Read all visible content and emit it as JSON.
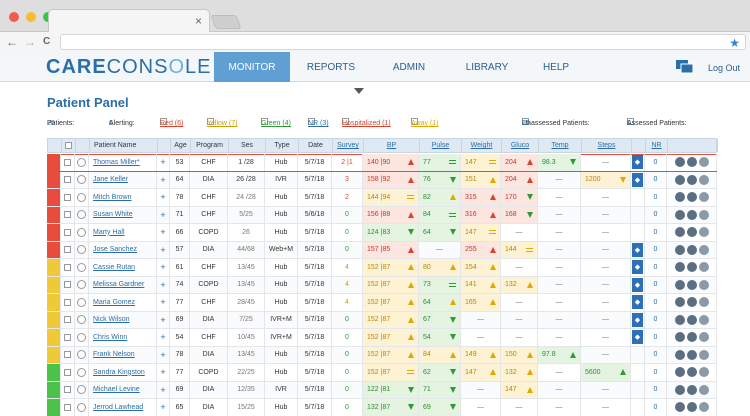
{
  "browser": {
    "close_glyph": "×",
    "back": "←",
    "forward": "→",
    "reload": "C",
    "bookmark": "★"
  },
  "header": {
    "logo_part1": "CARE",
    "logo_part2": "CONS",
    "logo_part3": "O",
    "logo_part4": "LE",
    "nav": [
      "MONITOR",
      "REPORTS",
      "ADMIN",
      "LIBRARY",
      "HELP"
    ],
    "active_nav": "MONITOR",
    "logout": "Log Out"
  },
  "panel": {
    "title": "Patient Panel",
    "patients_label": "Patients:",
    "patients_count": "20",
    "alerting_label": "Alerting:",
    "alerting_count": "6",
    "filters": [
      {
        "label": "Red (6)",
        "color": "#d9442d"
      },
      {
        "label": "Yellow (7)",
        "color": "#c8a000"
      },
      {
        "label": "Green (4)",
        "color": "#2e9a3a"
      },
      {
        "label": "NR (3)",
        "color": "#2b6ea8"
      },
      {
        "label": "Hospitalized (1)",
        "color": "#d9442d"
      },
      {
        "label": "Away (1)",
        "color": "#e0a800"
      }
    ],
    "unassessed_label": "Unassessed Patients:",
    "unassessed_count": "20",
    "assessed_label": "Assessed Patients:",
    "assessed_count": "0"
  },
  "columns": [
    "Patient Name",
    "Age",
    "Program",
    "Ses",
    "Type",
    "Date",
    "Survey",
    "BP",
    "Pulse",
    "Weight",
    "Gluco",
    "Temp",
    "Steps",
    "NR"
  ],
  "severity_colors": {
    "red": "#e84c3d",
    "yellow": "#f0c93a",
    "green": "#4cc24a"
  },
  "rows": [
    {
      "name": "Thomas  Miller*",
      "sev": "red",
      "age": "53",
      "program": "CHF",
      "ses": "1 /28",
      "type": "Hub",
      "date": "5/7/18",
      "survey": "2 |1",
      "survey_c": "red",
      "bp": "140 |90",
      "bp_c": "r",
      "bp_i": "up-r",
      "pulse": "77",
      "pulse_c": "g",
      "pulse_i": "eq-g",
      "weight": "147",
      "weight_c": "y",
      "weight_i": "eq-y",
      "gluco": "204",
      "gluco_c": "r",
      "gluco_i": "up-r",
      "temp": "98.3",
      "temp_c": "g",
      "temp_i": "dn-g",
      "steps": "—",
      "steps_c": "",
      "nr": true,
      "nrv": "0",
      "highlight": true
    },
    {
      "name": "Jane Keller",
      "sev": "red",
      "age": "64",
      "program": "DIA",
      "ses": "26 /28",
      "type": "IVR",
      "date": "5/7/18",
      "survey": "3",
      "survey_c": "red",
      "bp": "158 |92",
      "bp_c": "r",
      "bp_i": "up-r",
      "pulse": "76",
      "pulse_c": "g",
      "pulse_i": "dn-g",
      "weight": "151",
      "weight_c": "y",
      "weight_i": "up-y",
      "gluco": "204",
      "gluco_c": "r",
      "gluco_i": "up-r",
      "temp": "—",
      "temp_c": "",
      "temp_i": "",
      "steps": "1200",
      "steps_c": "y",
      "steps_i": "dn-y",
      "nr": true,
      "nrv": "0"
    },
    {
      "name": "Mitch Brown",
      "sev": "red",
      "age": "78",
      "program": "CHF",
      "ses": "24 /28",
      "type": "Hub",
      "date": "5/7/18",
      "survey": "2",
      "survey_c": "red",
      "bp": "144 |94",
      "bp_c": "y",
      "bp_i": "eq-y",
      "pulse": "82",
      "pulse_c": "g",
      "pulse_i": "up-y",
      "weight": "315",
      "weight_c": "r",
      "weight_i": "up-r",
      "gluco": "170",
      "gluco_c": "r",
      "gluco_i": "dn-g",
      "temp": "—",
      "temp_c": "",
      "temp_i": "",
      "steps": "—",
      "steps_c": "",
      "nr": false,
      "nrv": "0"
    },
    {
      "name": "Susan White",
      "sev": "red",
      "age": "71",
      "program": "CHF",
      "ses": "5/25",
      "type": "Hub",
      "date": "5/6/18",
      "survey": "0",
      "survey_c": "grn",
      "bp": "156 |88",
      "bp_c": "r",
      "bp_i": "up-r",
      "pulse": "84",
      "pulse_c": "g",
      "pulse_i": "eq-g",
      "weight": "316",
      "weight_c": "r",
      "weight_i": "up-r",
      "gluco": "168",
      "gluco_c": "r",
      "gluco_i": "dn-g",
      "temp": "—",
      "temp_c": "",
      "temp_i": "",
      "steps": "—",
      "steps_c": "",
      "nr": false,
      "nrv": "0"
    },
    {
      "name": "Marty Hall",
      "sev": "red",
      "age": "66",
      "program": "COPD",
      "ses": "26",
      "type": "Hub",
      "date": "5/7/18",
      "survey": "0",
      "survey_c": "grn",
      "bp": "124 |83",
      "bp_c": "g",
      "bp_i": "dn-g",
      "pulse": "64",
      "pulse_c": "g",
      "pulse_i": "dn-g",
      "weight": "147",
      "weight_c": "y",
      "weight_i": "eq-y",
      "gluco": "—",
      "gluco_c": "",
      "gluco_i": "",
      "temp": "—",
      "temp_c": "",
      "temp_i": "",
      "steps": "—",
      "steps_c": "",
      "nr": false,
      "nrv": "0"
    },
    {
      "name": "Jose Sanchez",
      "sev": "red",
      "age": "57",
      "program": "DIA",
      "ses": "44/68",
      "type": "Web+M",
      "date": "5/7/18",
      "survey": "0",
      "survey_c": "grn",
      "bp": "157 |85",
      "bp_c": "r",
      "bp_i": "up-r",
      "pulse": "—",
      "pulse_c": "",
      "pulse_i": "",
      "weight": "255",
      "weight_c": "r",
      "weight_i": "up-r",
      "gluco": "144",
      "gluco_c": "y",
      "gluco_i": "eq-y",
      "temp": "—",
      "temp_c": "",
      "temp_i": "",
      "steps": "—",
      "steps_c": "",
      "nr": true,
      "nrv": "0"
    },
    {
      "name": "Cassie Rutan",
      "sev": "yellow",
      "age": "61",
      "program": "CHF",
      "ses": "13/45",
      "type": "Hub",
      "date": "5/7/18",
      "survey": "4",
      "survey_c": "yel",
      "bp": "152 |87",
      "bp_c": "y",
      "bp_i": "up-y",
      "pulse": "80",
      "pulse_c": "y",
      "pulse_i": "up-y",
      "weight": "154",
      "weight_c": "y",
      "weight_i": "up-y",
      "gluco": "—",
      "gluco_c": "",
      "gluco_i": "",
      "temp": "—",
      "temp_c": "",
      "temp_i": "",
      "steps": "—",
      "steps_c": "",
      "nr": true,
      "nrv": "0"
    },
    {
      "name": "Melissa Gardner",
      "sev": "yellow",
      "age": "74",
      "program": "COPD",
      "ses": "13/45",
      "type": "Hub",
      "date": "5/7/18",
      "survey": "4",
      "survey_c": "yel",
      "bp": "152 |87",
      "bp_c": "y",
      "bp_i": "up-y",
      "pulse": "73",
      "pulse_c": "g",
      "pulse_i": "eq-g",
      "weight": "141",
      "weight_c": "y",
      "weight_i": "up-y",
      "gluco": "132",
      "gluco_c": "y",
      "gluco_i": "up-y",
      "temp": "—",
      "temp_c": "",
      "temp_i": "",
      "steps": "—",
      "steps_c": "",
      "nr": true,
      "nrv": "0"
    },
    {
      "name": "Maria Gomez",
      "sev": "yellow",
      "age": "77",
      "program": "CHF",
      "ses": "28/45",
      "type": "Hub",
      "date": "5/7/18",
      "survey": "4",
      "survey_c": "yel",
      "bp": "152 |87",
      "bp_c": "y",
      "bp_i": "up-y",
      "pulse": "64",
      "pulse_c": "g",
      "pulse_i": "up-y",
      "weight": "165",
      "weight_c": "y",
      "weight_i": "up-y",
      "gluco": "—",
      "gluco_c": "",
      "gluco_i": "",
      "temp": "—",
      "temp_c": "",
      "temp_i": "",
      "steps": "—",
      "steps_c": "",
      "nr": true,
      "nrv": "0"
    },
    {
      "name": "Nick Wilson",
      "sev": "yellow",
      "age": "69",
      "program": "DIA",
      "ses": "7/25",
      "type": "IVR+M",
      "date": "5/7/18",
      "survey": "0",
      "survey_c": "grn",
      "bp": "152 |87",
      "bp_c": "y",
      "bp_i": "up-y",
      "pulse": "67",
      "pulse_c": "g",
      "pulse_i": "dn-g",
      "weight": "—",
      "weight_c": "",
      "weight_i": "",
      "gluco": "—",
      "gluco_c": "",
      "gluco_i": "",
      "temp": "—",
      "temp_c": "",
      "temp_i": "",
      "steps": "—",
      "steps_c": "",
      "nr": true,
      "nrv": "0"
    },
    {
      "name": "Chris Winn",
      "sev": "yellow",
      "age": "54",
      "program": "CHF",
      "ses": "10/45",
      "type": "IVR+M",
      "date": "5/7/18",
      "survey": "0",
      "survey_c": "grn",
      "bp": "152 |87",
      "bp_c": "y",
      "bp_i": "up-y",
      "pulse": "54",
      "pulse_c": "g",
      "pulse_i": "dn-g",
      "weight": "—",
      "weight_c": "",
      "weight_i": "",
      "gluco": "—",
      "gluco_c": "",
      "gluco_i": "",
      "temp": "—",
      "temp_c": "",
      "temp_i": "",
      "steps": "—",
      "steps_c": "",
      "nr": true,
      "nrv": "0"
    },
    {
      "name": "Frank Nelson",
      "sev": "yellow",
      "age": "78",
      "program": "DIA",
      "ses": "13/45",
      "type": "Hub",
      "date": "5/7/18",
      "survey": "0",
      "survey_c": "grn",
      "bp": "152 |87",
      "bp_c": "y",
      "bp_i": "up-y",
      "pulse": "84",
      "pulse_c": "y",
      "pulse_i": "up-y",
      "weight": "149",
      "weight_c": "y",
      "weight_i": "up-y",
      "gluco": "150",
      "gluco_c": "y",
      "gluco_i": "up-y",
      "temp": "97.8",
      "temp_c": "g",
      "temp_i": "up-g",
      "steps": "—",
      "steps_c": "",
      "nr": false,
      "nrv": "0"
    },
    {
      "name": "Sandra Kingston",
      "sev": "green",
      "age": "77",
      "program": "COPD",
      "ses": "22/25",
      "type": "Hub",
      "date": "5/7/18",
      "survey": "0",
      "survey_c": "grn",
      "bp": "152 |87",
      "bp_c": "y",
      "bp_i": "eq-y",
      "pulse": "62",
      "pulse_c": "g",
      "pulse_i": "dn-g",
      "weight": "147",
      "weight_c": "y",
      "weight_i": "up-y",
      "gluco": "132",
      "gluco_c": "y",
      "gluco_i": "up-y",
      "temp": "—",
      "temp_c": "",
      "temp_i": "",
      "steps": "5600",
      "steps_c": "g",
      "steps_i": "up-g",
      "nr": false,
      "nrv": "0"
    },
    {
      "name": "Michael Levine",
      "sev": "green",
      "age": "69",
      "program": "DIA",
      "ses": "12/35",
      "type": "IVR",
      "date": "5/7/18",
      "survey": "0",
      "survey_c": "grn",
      "bp": "122 |81",
      "bp_c": "g",
      "bp_i": "dn-g",
      "pulse": "71",
      "pulse_c": "g",
      "pulse_i": "dn-g",
      "weight": "—",
      "weight_c": "",
      "weight_i": "",
      "gluco": "147",
      "gluco_c": "y",
      "gluco_i": "up-y",
      "temp": "—",
      "temp_c": "",
      "temp_i": "",
      "steps": "—",
      "steps_c": "",
      "nr": false,
      "nrv": "0"
    },
    {
      "name": "Jerrod Lawhead",
      "sev": "green",
      "age": "65",
      "program": "DIA",
      "ses": "15/25",
      "type": "Hub",
      "date": "5/7/18",
      "survey": "0",
      "survey_c": "grn",
      "bp": "132 |87",
      "bp_c": "g",
      "bp_i": "dn-g",
      "pulse": "69",
      "pulse_c": "g",
      "pulse_i": "dn-g",
      "weight": "—",
      "weight_c": "",
      "weight_i": "",
      "gluco": "—",
      "gluco_c": "",
      "gluco_i": "",
      "temp": "—",
      "temp_c": "",
      "temp_i": "",
      "steps": "—",
      "steps_c": "",
      "nr": false,
      "nrv": "0"
    }
  ]
}
